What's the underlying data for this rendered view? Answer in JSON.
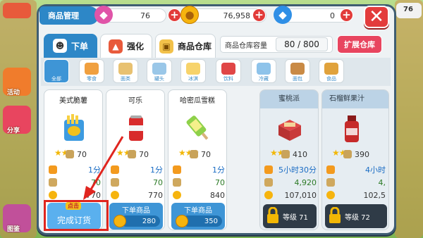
{
  "header": {
    "title": "商品管理",
    "close_icon": "close-icon"
  },
  "currencies": [
    {
      "icon": "gem-icon",
      "value": "76",
      "color": "#e054a8"
    },
    {
      "icon": "coin-icon",
      "value": "76,958",
      "color": "#f6b40e"
    },
    {
      "icon": "diamond-icon",
      "value": "0",
      "color": "#2f8fe6"
    }
  ],
  "tabs": [
    {
      "label": "下单",
      "active": true
    },
    {
      "label": "强化",
      "active": false
    },
    {
      "label": "商品仓库",
      "active": false
    }
  ],
  "warehouse": {
    "label": "商品仓库容量",
    "value": "80 / 800",
    "expand_label": "扩展仓库"
  },
  "categories": [
    {
      "label": "全部",
      "active": true
    },
    {
      "label": "零食",
      "active": false
    },
    {
      "label": "面类",
      "active": false
    },
    {
      "label": "罐头",
      "active": false
    },
    {
      "label": "冰淇",
      "active": false
    },
    {
      "label": "饮料",
      "active": false
    },
    {
      "label": "冷藏",
      "active": false
    },
    {
      "label": "面包",
      "active": false
    },
    {
      "label": "食品",
      "active": false
    }
  ],
  "products": [
    {
      "name": "美式脆薯",
      "stars": 2,
      "level_value": "70",
      "time": "1分",
      "qty": "70",
      "price": "770",
      "action": "complete",
      "badge": "点击",
      "action_label": "完成订货"
    },
    {
      "name": "可乐",
      "stars": 2,
      "level_value": "70",
      "time": "1分",
      "qty": "70",
      "price": "770",
      "action": "order",
      "action_label": "下单商品",
      "cost": "280"
    },
    {
      "name": "哈密瓜雪糕",
      "stars": 2,
      "level_value": "70",
      "time": "1分",
      "qty": "70",
      "price": "840",
      "action": "order",
      "action_label": "下单商品",
      "cost": "350"
    },
    {
      "name": "蜜桃派",
      "stars": 2,
      "level_value": "410",
      "time": "5小时30分",
      "qty": "4,920",
      "price": "107,010",
      "action": "locked",
      "action_label": "等级 71"
    },
    {
      "name": "石榴鲜果汁",
      "stars": 2,
      "level_value": "390",
      "time": "4小时",
      "qty": "4,",
      "price": "102,5",
      "action": "locked",
      "action_label": "等级 72"
    }
  ],
  "side_menu": [
    "活动",
    "分享",
    "图鉴"
  ],
  "right_badge": "76"
}
